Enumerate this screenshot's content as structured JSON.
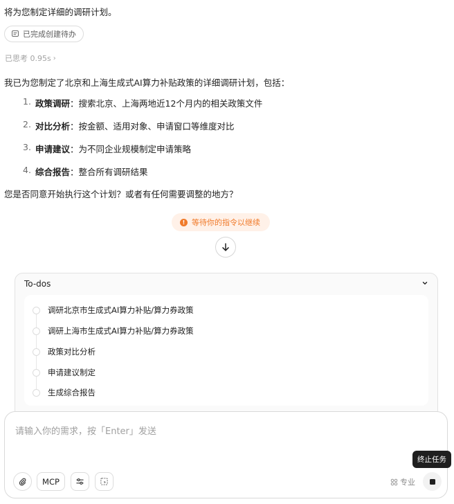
{
  "message": {
    "intro": "将为您制定详细的调研计划。",
    "done_chip": "已完成创建待办",
    "thinking": "已思考 0.95s",
    "summary": "我已为您制定了北京和上海生成式AI算力补贴政策的详细调研计划，包括：",
    "plan_items": [
      {
        "num": "1.",
        "title": "政策调研",
        "desc": "：搜索北京、上海两地近12个月内的相关政策文件"
      },
      {
        "num": "2.",
        "title": "对比分析",
        "desc": "：按金额、适用对象、申请窗口等维度对比"
      },
      {
        "num": "3.",
        "title": "申请建议",
        "desc": "：为不同企业规模制定申请策略"
      },
      {
        "num": "4.",
        "title": "综合报告",
        "desc": "：整合所有调研结果"
      }
    ],
    "question": "您是否同意开始执行这个计划？或者有任何需要调整的地方？"
  },
  "waiting_badge": "等待你的指令以继续",
  "todos": {
    "title": "To-dos",
    "items": [
      "调研北京市生成式AI算力补贴/算力券政策",
      "调研上海市生成式AI算力补贴/算力券政策",
      "政策对比分析",
      "申请建议制定",
      "生成综合报告"
    ]
  },
  "composer": {
    "placeholder": "请输入你的需求，按「Enter」发送",
    "mcp_label": "MCP",
    "pro_label": "专业",
    "stop_tooltip": "终止任务"
  },
  "icons": {
    "done_chip": "todo-list-icon",
    "thinking": "chevron-right-icon",
    "waiting": "info-icon",
    "scroll": "arrow-down-icon",
    "todo_toggle": "chevron-down-icon",
    "attach": "paperclip-icon",
    "settings": "sliders-icon",
    "canvas": "canvas-icon",
    "pro": "grid-icon",
    "stop": "stop-icon"
  },
  "colors": {
    "accent_orange": "#f07a2a",
    "waiting_bg": "#fff1e8",
    "tooltip_bg": "#1f1f1f"
  }
}
